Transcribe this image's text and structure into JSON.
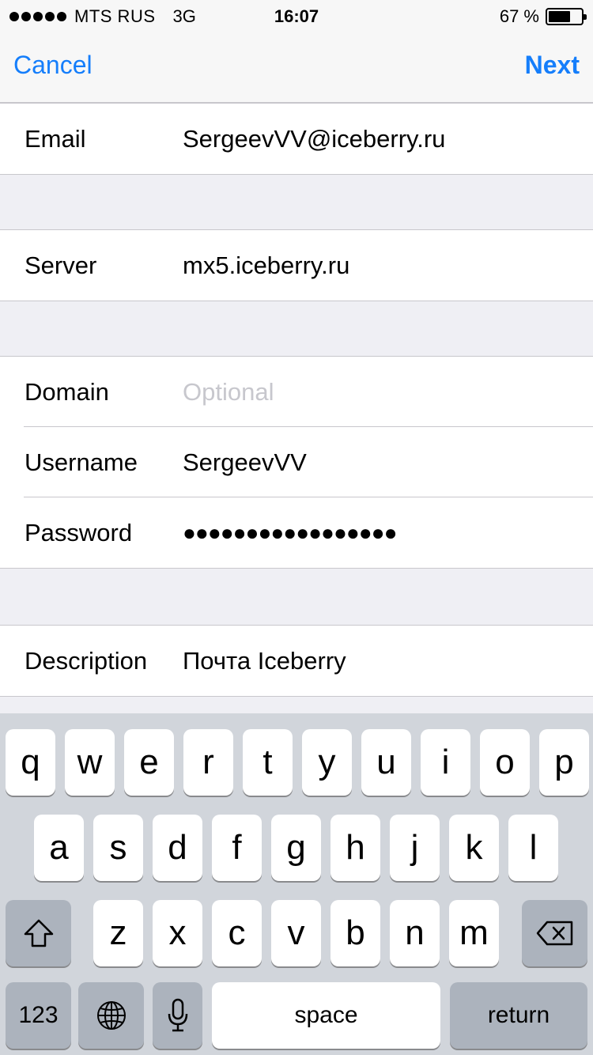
{
  "status_bar": {
    "carrier": "MTS RUS",
    "network": "3G",
    "time": "16:07",
    "battery": "67 %",
    "battery_level": 0.67
  },
  "nav": {
    "cancel_label": "Cancel",
    "next_label": "Next"
  },
  "form": {
    "email": {
      "label": "Email",
      "value": "SergeevVV@iceberry.ru"
    },
    "server": {
      "label": "Server",
      "value": "mx5.iceberry.ru"
    },
    "domain": {
      "label": "Domain",
      "placeholder": "Optional"
    },
    "username": {
      "label": "Username",
      "value": "SergeevVV"
    },
    "password": {
      "label": "Password",
      "value": "●●●●●●●●●●●●●●●●●"
    },
    "description": {
      "label": "Description",
      "value": "Почта Iceberry"
    }
  },
  "keyboard": {
    "row1": [
      "q",
      "w",
      "e",
      "r",
      "t",
      "y",
      "u",
      "i",
      "o",
      "p"
    ],
    "row2": [
      "a",
      "s",
      "d",
      "f",
      "g",
      "h",
      "j",
      "k",
      "l"
    ],
    "row3": [
      "z",
      "x",
      "c",
      "v",
      "b",
      "n",
      "m"
    ],
    "numbers_label": "123",
    "space_label": "space",
    "return_label": "return"
  },
  "colors": {
    "accent": "#157efb",
    "keyboard_bg": "#d1d5db",
    "dark_key": "#acb3bd"
  }
}
